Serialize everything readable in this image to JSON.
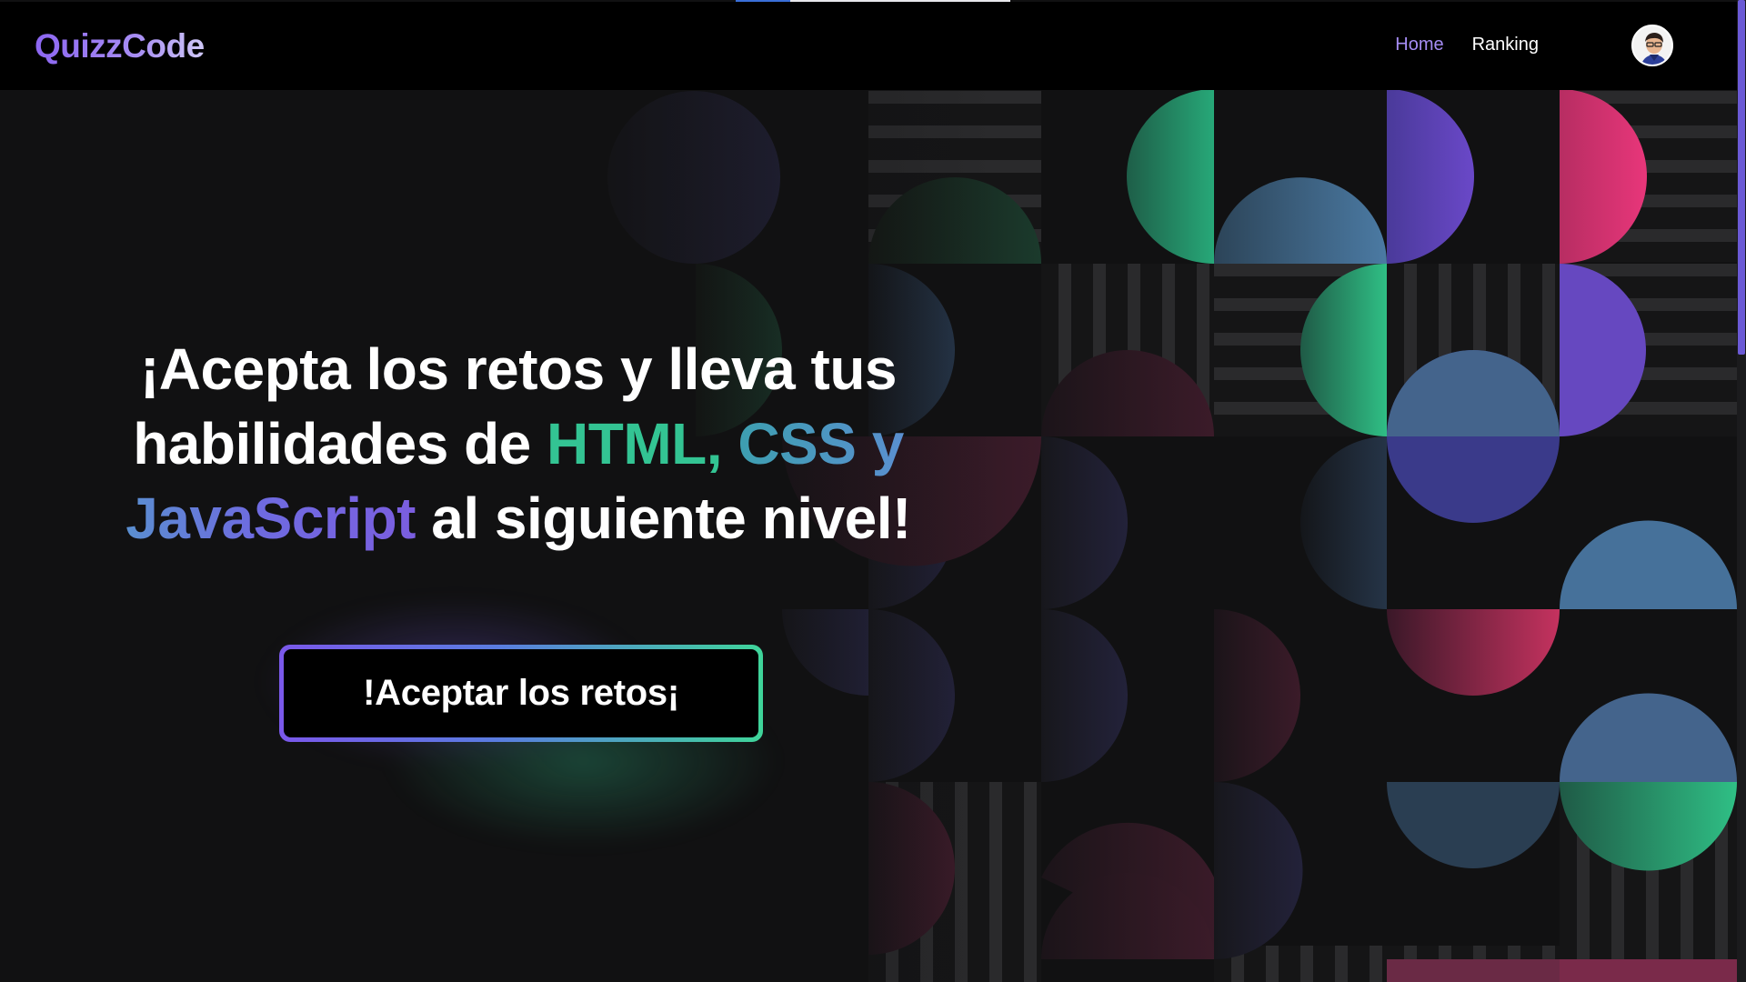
{
  "header": {
    "logo": "QuizzCode",
    "nav": [
      {
        "label": "Home",
        "active": true
      },
      {
        "label": "Ranking",
        "active": false
      }
    ],
    "avatar_icon": "user-avatar-icon"
  },
  "hero": {
    "title_part1": "¡Acepta los retos y lleva tus habilidades de ",
    "title_html": "HTML,",
    "title_css": "CSS y",
    "title_js": "JavaScript",
    "title_part2": " al siguiente nivel!",
    "cta_label": "!Aceptar los retos¡"
  },
  "colors": {
    "brand_purple": "#8c66f2",
    "brand_green": "#33c493",
    "brand_blue": "#4e7fb0",
    "brand_pink": "#e0336e",
    "background": "#111112"
  }
}
